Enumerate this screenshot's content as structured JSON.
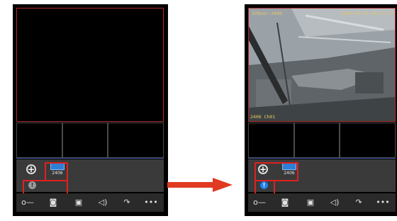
{
  "left_screen": {
    "device": {
      "label": "2406"
    },
    "info_badge": {
      "text": "!"
    }
  },
  "right_screen": {
    "video_overlay": {
      "name": "IPDoor-2406",
      "timestamp": "2014-04-21 04:37:37",
      "channel": "2406 Ch01"
    },
    "device": {
      "label": "2406"
    },
    "info_badge": {
      "text": "!"
    }
  },
  "toolbar_icons": [
    "unlock-key-icon",
    "camera-icon",
    "record-icon",
    "speaker-icon",
    "hangup-icon",
    "more-icon"
  ],
  "colors": {
    "highlight": "#e02020",
    "arrow": "#e03a20",
    "info_inactive": "#9a9a9a",
    "info_active": "#1f7ff0",
    "device_blue": "#2f7fd6"
  }
}
